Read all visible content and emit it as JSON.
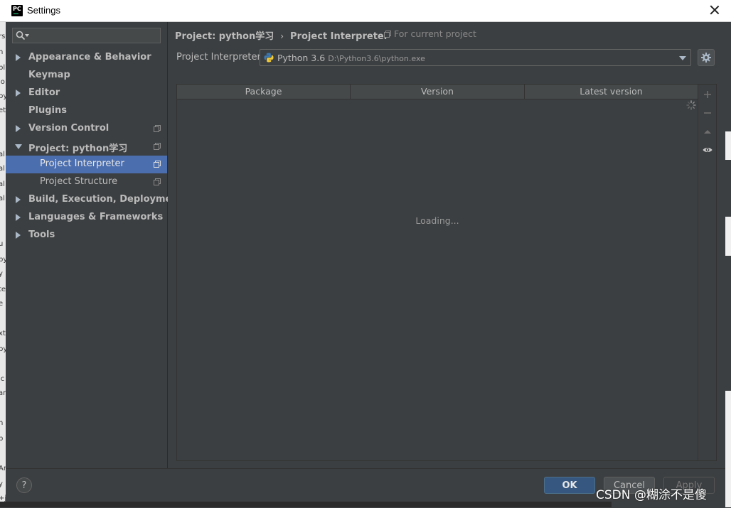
{
  "window": {
    "title": "Settings"
  },
  "sidebar": {
    "search_placeholder": "",
    "items": [
      {
        "label": "Appearance & Behavior",
        "arrow": "right",
        "copy": false,
        "level": 0
      },
      {
        "label": "Keymap",
        "arrow": "none",
        "copy": false,
        "level": 0
      },
      {
        "label": "Editor",
        "arrow": "right",
        "copy": false,
        "level": 0
      },
      {
        "label": "Plugins",
        "arrow": "none",
        "copy": false,
        "level": 0
      },
      {
        "label": "Version Control",
        "arrow": "right",
        "copy": true,
        "level": 0
      },
      {
        "label": "Project: python学习",
        "arrow": "down",
        "copy": true,
        "level": 0
      },
      {
        "label": "Project Interpreter",
        "arrow": "none",
        "copy": true,
        "level": 1,
        "selected": true
      },
      {
        "label": "Project Structure",
        "arrow": "none",
        "copy": true,
        "level": 1
      },
      {
        "label": "Build, Execution, Deployment",
        "arrow": "right",
        "copy": false,
        "level": 0
      },
      {
        "label": "Languages & Frameworks",
        "arrow": "right",
        "copy": false,
        "level": 0
      },
      {
        "label": "Tools",
        "arrow": "right",
        "copy": false,
        "level": 0
      }
    ]
  },
  "main": {
    "breadcrumb": {
      "project": "Project: python学习",
      "separator": "›",
      "page": "Project Interpreter"
    },
    "scope_note": "For current project",
    "interpreter": {
      "label": "Project Interpreter:",
      "name": "Python 3.6",
      "path": "D:\\Python3.6\\python.exe"
    },
    "table": {
      "columns": [
        "Package",
        "Version",
        "Latest version"
      ],
      "loading_text": "Loading..."
    }
  },
  "footer": {
    "help_label": "?",
    "ok_label": "OK",
    "cancel_label": "Cancel",
    "apply_label": "Apply"
  },
  "watermark": "CSDN @糊涂不是傻",
  "colors": {
    "selection": "#4b6eaf",
    "background": "#3c3f41",
    "ok_button": "#365880"
  }
}
